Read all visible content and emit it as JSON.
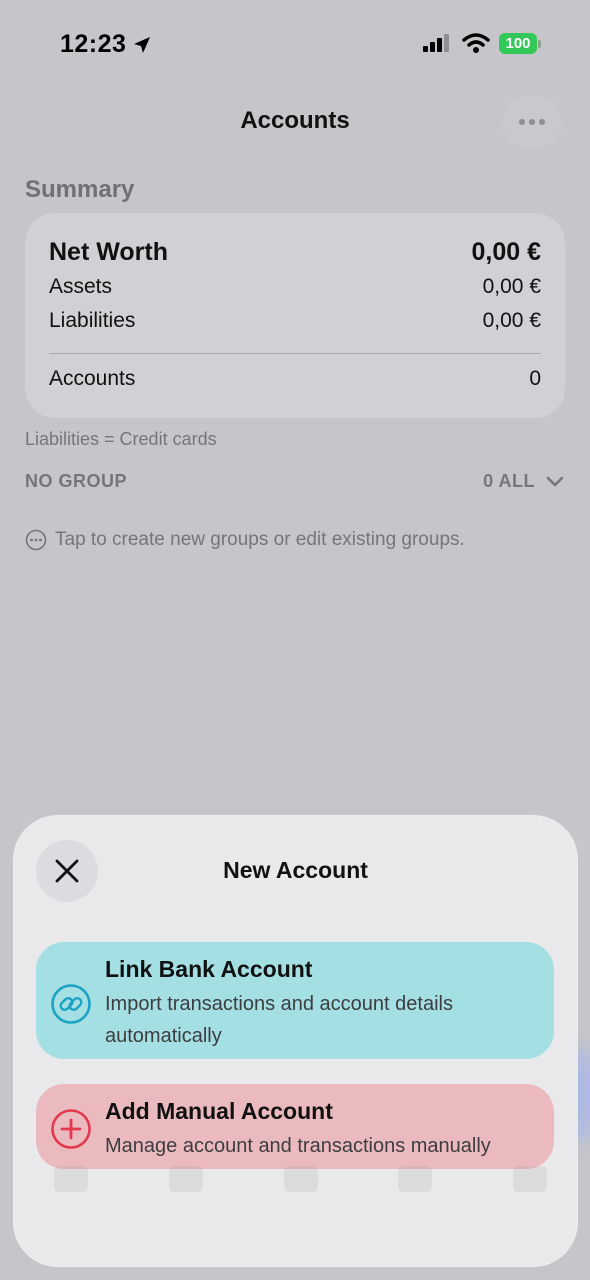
{
  "status_bar": {
    "time": "12:23",
    "battery": "100"
  },
  "nav": {
    "title": "Accounts"
  },
  "summary": {
    "section_title": "Summary",
    "net_worth_label": "Net Worth",
    "net_worth_value": "0,00 €",
    "assets_label": "Assets",
    "assets_value": "0,00 €",
    "liabilities_label": "Liabilities",
    "liabilities_value": "0,00 €",
    "accounts_label": "Accounts",
    "accounts_value": "0"
  },
  "note": "Liabilities = Credit cards",
  "group": {
    "label": "NO GROUP",
    "count": "0 ALL"
  },
  "tip": "Tap to create new groups or edit existing groups.",
  "sheet": {
    "title": "New Account",
    "options": [
      {
        "title": "Link Bank Account",
        "description": "Import transactions and account details automatically",
        "icon": "link-icon",
        "color": "#a4dfe3"
      },
      {
        "title": "Add Manual Account",
        "description": "Manage account and transactions manually",
        "icon": "plus-circle-icon",
        "color": "#eababf"
      }
    ]
  },
  "colors": {
    "accent_teal": "#1aa3c4",
    "accent_red": "#e5384d",
    "battery_green": "#34c759"
  }
}
